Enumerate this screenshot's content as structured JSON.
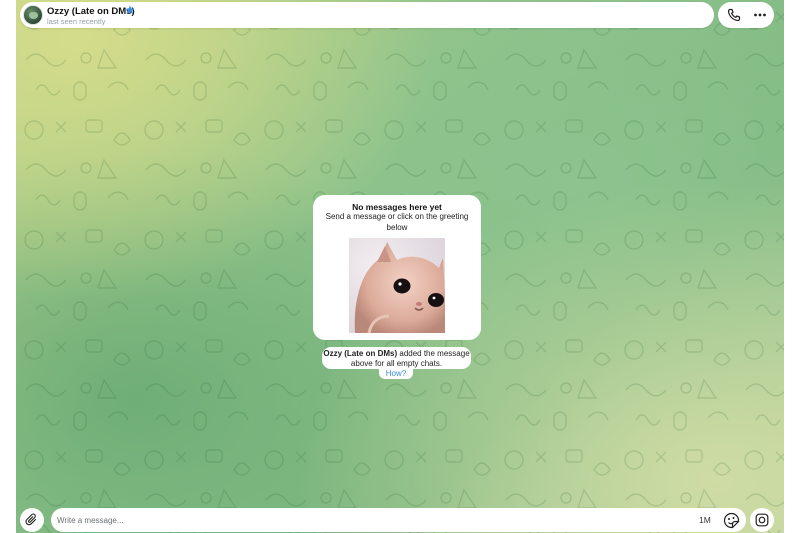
{
  "header": {
    "chat_name": "Ozzy (Late on DMs)",
    "status": "last seen recently",
    "verified_icon": "star-icon",
    "call_icon": "phone-icon",
    "menu_icon": "more-icon"
  },
  "empty_chat": {
    "title": "No messages here yet",
    "subtitle": "Send a message or click on the greeting below",
    "sticker": "cat-sticker"
  },
  "service_message": {
    "name": "Ozzy (Late on DMs)",
    "text": " added the message above for all empty chats.",
    "link": "How?"
  },
  "composer": {
    "placeholder": "Write a message...",
    "timer_label": "1M",
    "attach_icon": "paperclip-icon",
    "sticker_icon": "sticker-icon",
    "camera_icon": "camera-icon"
  },
  "colors": {
    "accent": "#3b8ed4",
    "star": "#3a8ee6",
    "background_green": "#8fc38a"
  }
}
